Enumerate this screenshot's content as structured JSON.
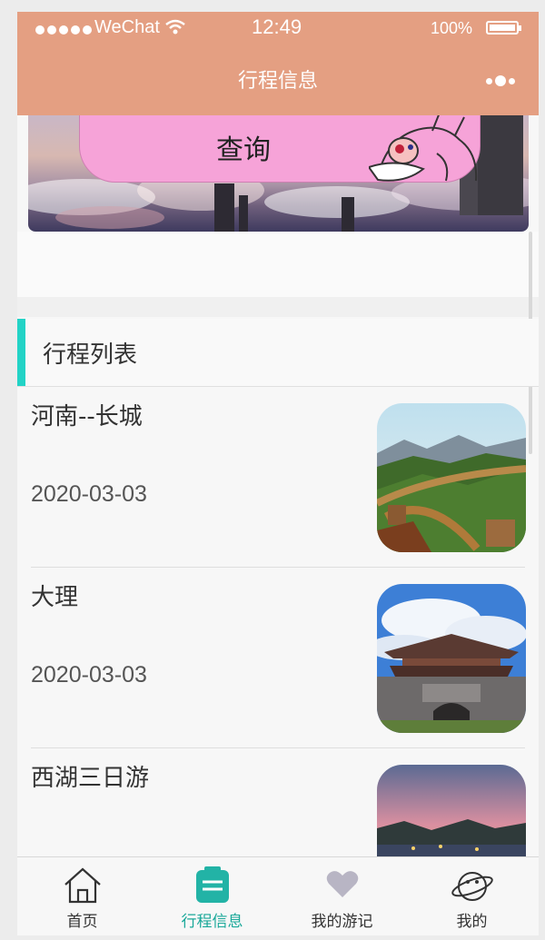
{
  "status_bar": {
    "carrier": "WeChat",
    "time": "12:49",
    "battery": "100%"
  },
  "nav": {
    "title": "行程信息"
  },
  "banner": {
    "query_label": "查询"
  },
  "section": {
    "title": "行程列表"
  },
  "trips": [
    {
      "name": "河南--长城",
      "date": "2020-03-03"
    },
    {
      "name": "大理",
      "date": "2020-03-03"
    },
    {
      "name": "西湖三日游",
      "date": ""
    }
  ],
  "tabbar": {
    "items": [
      {
        "label": "首页",
        "icon": "home-icon"
      },
      {
        "label": "行程信息",
        "icon": "clipboard-icon"
      },
      {
        "label": "我的游记",
        "icon": "heart-icon"
      },
      {
        "label": "我的",
        "icon": "planet-icon"
      }
    ],
    "active_index": 1
  },
  "colors": {
    "header": "#e49f82",
    "accent": "#22d3c6",
    "active_tab": "#19a899",
    "query_button": "#f6a3d8"
  }
}
